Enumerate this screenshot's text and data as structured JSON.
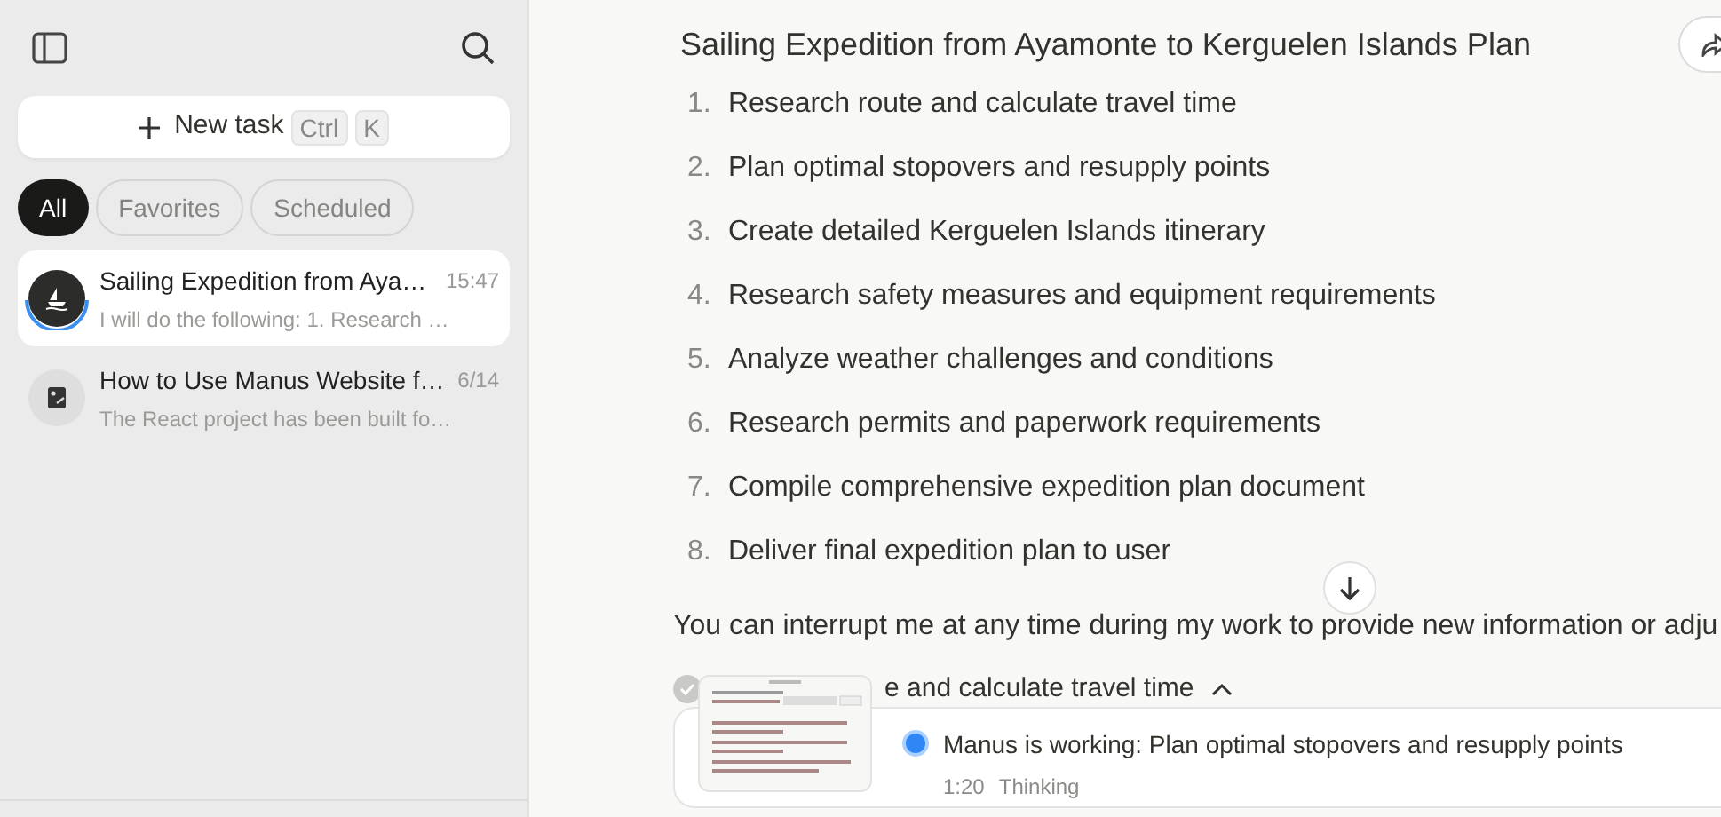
{
  "sidebar": {
    "new_task": {
      "label": "New task",
      "shortcut": [
        "Ctrl",
        "K"
      ]
    },
    "filters": [
      {
        "label": "All",
        "selected": true
      },
      {
        "label": "Favorites",
        "selected": false
      },
      {
        "label": "Scheduled",
        "selected": false
      }
    ],
    "tasks": [
      {
        "title": "Sailing Expedition from Aya…",
        "time": "15:47",
        "preview": "I will do the following: 1. Research …",
        "selected": true,
        "kind": "boat",
        "running": true
      },
      {
        "title": "How to Use Manus Website f…",
        "time": "6/14",
        "preview": "The React project has been built fo…",
        "selected": false,
        "kind": "document",
        "running": false
      }
    ]
  },
  "main": {
    "title": "Sailing Expedition from Ayamonte to Kerguelen Islands Plan",
    "steps": [
      {
        "number": "1.",
        "text": "Research route and calculate travel time"
      },
      {
        "number": "2.",
        "text": "Plan optimal stopovers and resupply points"
      },
      {
        "number": "3.",
        "text": "Create detailed Kerguelen Islands itinerary"
      },
      {
        "number": "4.",
        "text": "Research safety measures and equipment requirements"
      },
      {
        "number": "5.",
        "text": "Analyze weather challenges and conditions"
      },
      {
        "number": "6.",
        "text": "Research permits and paperwork requirements"
      },
      {
        "number": "7.",
        "text": "Compile comprehensive expedition plan document"
      },
      {
        "number": "8.",
        "text": "Deliver final expedition plan to user"
      }
    ],
    "message": "You can interrupt me at any time during my work to provide new information or adju",
    "current_step": {
      "text": "e and calculate travel time",
      "done": true
    },
    "status": {
      "text": "Manus is working: Plan optimal stopovers and resupply points",
      "elapsed": "1:20",
      "state": "Thinking"
    }
  }
}
